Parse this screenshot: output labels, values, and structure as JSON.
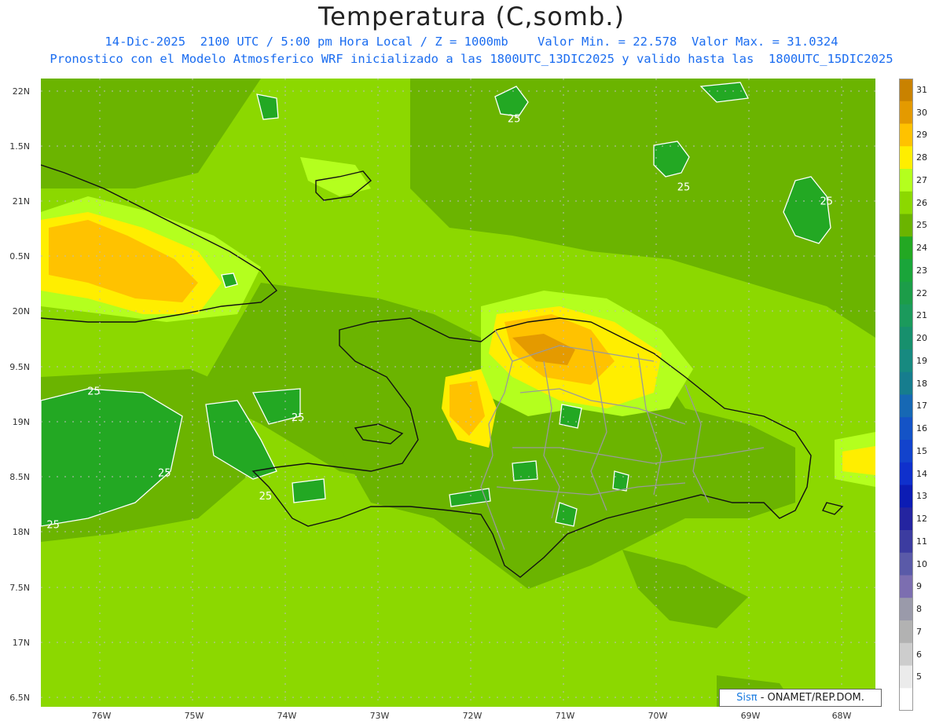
{
  "title": "Temperatura (C,somb.)",
  "subtitle_line1": "14-Dic-2025  2100 UTC / 5:00 pm Hora Local / Z = 1000mb    Valor Min. = 22.578  Valor Max. = 31.0324",
  "subtitle_line2": "Pronostico con el Modelo Atmosferico WRF inicializado a las 1800UTC_13DIC2025 y valido hasta las  1800UTC_15DIC2025",
  "axes": {
    "y_labels": [
      "22N",
      "1.5N",
      "21N",
      "0.5N",
      "20N",
      "9.5N",
      "19N",
      "8.5N",
      "18N",
      "7.5N",
      "17N",
      "6.5N"
    ],
    "x_labels": [
      "76W",
      "75W",
      "74W",
      "73W",
      "72W",
      "71W",
      "70W",
      "69W",
      "68W"
    ]
  },
  "contour_labels": [
    {
      "text": "25",
      "lon": -71.55,
      "lat": 21.72
    },
    {
      "text": "25",
      "lon": -69.72,
      "lat": 21.1
    },
    {
      "text": "25",
      "lon": -68.18,
      "lat": 20.97
    },
    {
      "text": "25",
      "lon": -76.08,
      "lat": 19.25
    },
    {
      "text": "25",
      "lon": -73.88,
      "lat": 19.01
    },
    {
      "text": "25",
      "lon": -75.32,
      "lat": 18.51
    },
    {
      "text": "25",
      "lon": -74.23,
      "lat": 18.3
    },
    {
      "text": "25",
      "lon": -76.52,
      "lat": 18.04
    }
  ],
  "legend": {
    "labels": [
      "31",
      "30",
      "29",
      "28",
      "27",
      "26",
      "25",
      "24",
      "23",
      "22",
      "21",
      "20",
      "19",
      "18",
      "17",
      "16",
      "15",
      "14",
      "13",
      "12",
      "11",
      "10",
      "9",
      "8",
      "7",
      "6",
      "5"
    ],
    "colors": [
      "#c98200",
      "#e49a00",
      "#ffc200",
      "#ffee00",
      "#b4ff1e",
      "#8cd800",
      "#6bb400",
      "#23a823",
      "#1aa53a",
      "#1c9d49",
      "#1b9a5c",
      "#17906d",
      "#178a80",
      "#167d8e",
      "#1668b4",
      "#1453c6",
      "#1243cc",
      "#0f30cc",
      "#0c1cb4",
      "#2424a0",
      "#3c3ca0",
      "#5a5aa8",
      "#7c6eb0",
      "#9a9aaa",
      "#b2b2b2",
      "#cdcdcd",
      "#ebebeb",
      "#ffffff"
    ]
  },
  "credit": {
    "brand": "Sisπ",
    "text": " - ONAMET/REP.DOM."
  }
}
